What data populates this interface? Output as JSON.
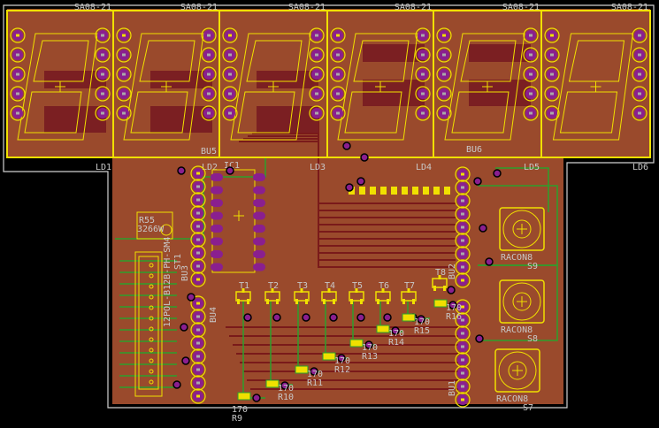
{
  "colors": {
    "copper": "#9a4a2c",
    "top_trace": "#7a1a1a",
    "bottom_trace": "#2da02d",
    "silkscreen": "#f0e000",
    "pad": "#8a1f8f",
    "outline": "#d0d0d0",
    "label": "#c8c8c8"
  },
  "displays": [
    {
      "part": "SA08-21",
      "name": "LD1"
    },
    {
      "part": "SA08-21",
      "name": "LD2"
    },
    {
      "part": "SA08-21",
      "name": "LD3"
    },
    {
      "part": "SA08-21",
      "name": "LD4"
    },
    {
      "part": "SA08-21",
      "name": "LD5"
    },
    {
      "part": "SA08-21",
      "name": "LD6"
    }
  ],
  "ic": {
    "name": "IC1"
  },
  "headers": [
    {
      "name": "BU5"
    },
    {
      "name": "BU3"
    },
    {
      "name": "BU4"
    },
    {
      "name": "BU6"
    },
    {
      "name": "BU2"
    },
    {
      "name": "BU1"
    }
  ],
  "trimmer": {
    "name": "R55",
    "value": "3266W"
  },
  "connector": {
    "name": "ST1",
    "value": "12POL-B12B-PH-SM4"
  },
  "transistors": [
    "T1",
    "T2",
    "T3",
    "T4",
    "T5",
    "T6",
    "T7",
    "T8"
  ],
  "resistors": [
    {
      "name": "R9",
      "value": "170"
    },
    {
      "name": "R10",
      "value": "170"
    },
    {
      "name": "R11",
      "value": "170"
    },
    {
      "name": "R12",
      "value": "170"
    },
    {
      "name": "R13",
      "value": "170"
    },
    {
      "name": "R14",
      "value": "170"
    },
    {
      "name": "R15",
      "value": "170"
    },
    {
      "name": "R16",
      "value": "170"
    }
  ],
  "switches": [
    {
      "name": "S9",
      "value": "RACON8"
    },
    {
      "name": "S8",
      "value": "RACON8"
    },
    {
      "name": "S7",
      "value": "RACON8"
    }
  ]
}
